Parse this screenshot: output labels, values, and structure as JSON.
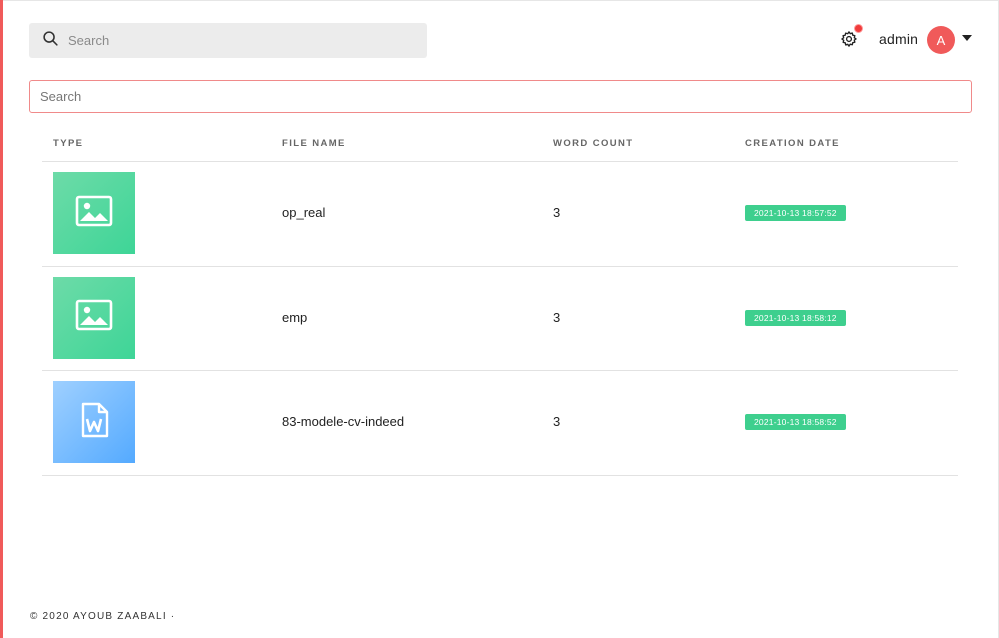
{
  "topbar": {
    "search_placeholder": "Search",
    "user_name": "admin",
    "avatar_initial": "A"
  },
  "filter": {
    "placeholder": "Search"
  },
  "table": {
    "headers": {
      "type": "TYPE",
      "file_name": "FILE NAME",
      "word_count": "WORD COUNT",
      "creation_date": "CREATION DATE"
    },
    "rows": [
      {
        "type": "image",
        "file_name": "op_real",
        "word_count": "3",
        "creation_date": "2021-10-13 18:57:52"
      },
      {
        "type": "image",
        "file_name": "emp",
        "word_count": "3",
        "creation_date": "2021-10-13 18:58:12"
      },
      {
        "type": "word-document",
        "file_name": "83-modele-cv-indeed",
        "word_count": "3",
        "creation_date": "2021-10-13 18:58:52"
      }
    ]
  },
  "footer": {
    "text": "© 2020 AYOUB ZAABALI ·"
  },
  "colors": {
    "accent": "#f05a5a",
    "badge": "#3ecf8e",
    "image_thumb": "#3ed597",
    "doc_thumb": "#54aaff",
    "notification_dot": "#f03c3c"
  },
  "icons": {
    "search": "search-icon",
    "settings": "gear-icon",
    "dropdown": "caret-down-icon",
    "image_file": "image-icon",
    "word_file": "word-document-icon"
  }
}
